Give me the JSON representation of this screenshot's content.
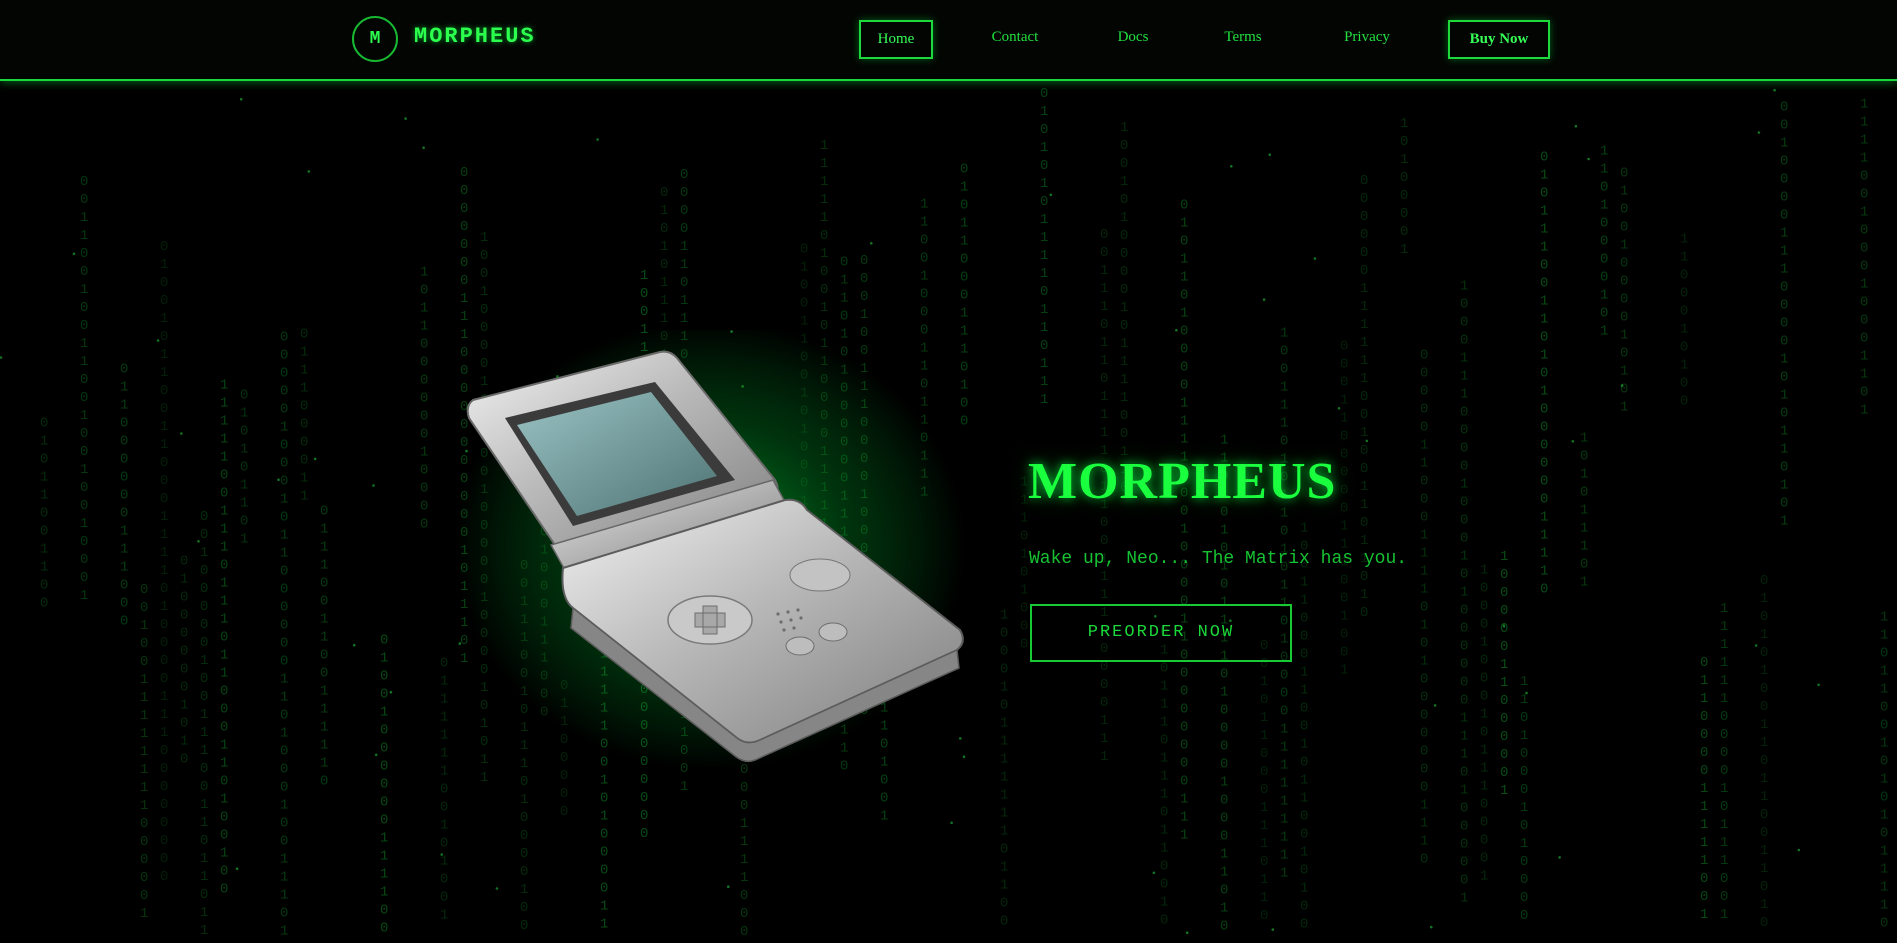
{
  "brand": {
    "logo_letter": "M",
    "name": "MORPHEUS"
  },
  "nav": {
    "home": "Home",
    "contact": "Contact",
    "docs": "Docs",
    "terms": "Terms",
    "privacy": "Privacy",
    "buy": "Buy Now"
  },
  "hero": {
    "title": "MORPHEUS",
    "subtitle": "Wake up, Neo... The Matrix has you.",
    "cta_label": "PREORDER NOW"
  },
  "colors": {
    "accent": "#00ff41",
    "background": "#000000",
    "rain": "#0b5a1a"
  },
  "icons": {
    "device": "handheld-console-image"
  }
}
